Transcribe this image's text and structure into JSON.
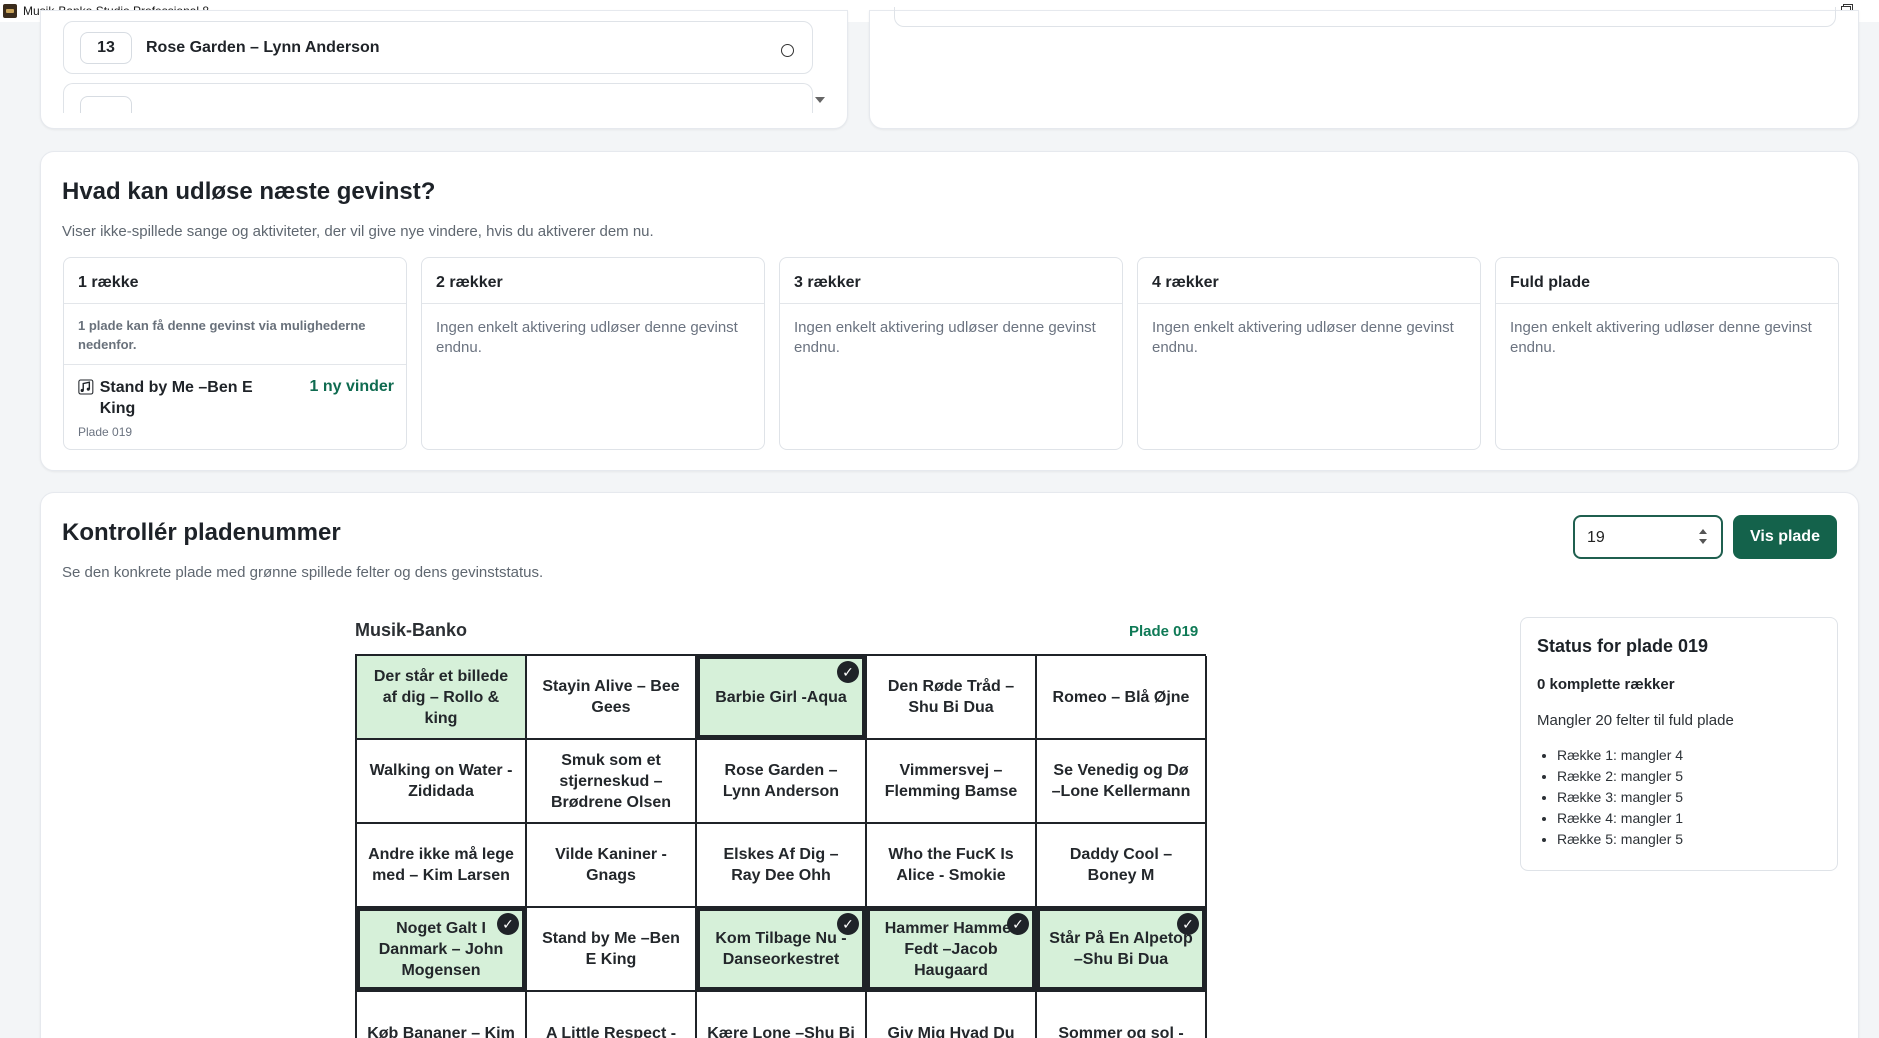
{
  "window": {
    "title": "Musik-Banko Studio Professional 8"
  },
  "song_list": {
    "visible_item": {
      "number": "13",
      "title": "Rose Garden – Lynn Anderson"
    }
  },
  "gains": {
    "title": "Hvad kan udløse næste gevinst?",
    "subtitle": "Viser ikke-spillede sange og aktiviteter, der vil give nye vindere, hvis du aktiverer dem nu.",
    "columns": [
      {
        "heading": "1 række",
        "info": "1 plade kan få denne gevinst via mulighederne nedenfor.",
        "item": {
          "song": "Stand by Me –Ben E King",
          "winners": "1 ny vinder",
          "plate": "Plade 019"
        }
      },
      {
        "heading": "2 rækker",
        "empty": "Ingen enkelt aktivering udløser denne gevinst endnu."
      },
      {
        "heading": "3 rækker",
        "empty": "Ingen enkelt aktivering udløser denne gevinst endnu."
      },
      {
        "heading": "4 rækker",
        "empty": "Ingen enkelt aktivering udløser denne gevinst endnu."
      },
      {
        "heading": "Fuld plade",
        "empty": "Ingen enkelt aktivering udløser denne gevinst endnu."
      }
    ]
  },
  "check": {
    "title": "Kontrollér pladenummer",
    "subtitle": "Se den konkrete plade med grønne spillede felter og dens gevinststatus.",
    "input_value": "19",
    "button_label": "Vis plade",
    "board_label": "Musik-Banko",
    "board_plate": "Plade 019",
    "cells": [
      {
        "text": "Der står et billede af dig – Rollo & king",
        "played": true,
        "bold": false,
        "check": false
      },
      {
        "text": "Stayin Alive – Bee Gees",
        "played": false,
        "bold": false,
        "check": false
      },
      {
        "text": "Barbie Girl -Aqua",
        "played": true,
        "bold": true,
        "check": true
      },
      {
        "text": "Den Røde Tråd – Shu Bi Dua",
        "played": false,
        "bold": false,
        "check": false
      },
      {
        "text": "Romeo – Blå Øjne",
        "played": false,
        "bold": false,
        "check": false
      },
      {
        "text": "Walking on Water -Zididada",
        "played": false,
        "bold": false,
        "check": false
      },
      {
        "text": "Smuk som et stjerneskud –Brødrene Olsen",
        "played": false,
        "bold": false,
        "check": false
      },
      {
        "text": "Rose Garden – Lynn Anderson",
        "played": false,
        "bold": false,
        "check": false
      },
      {
        "text": "Vimmersvej – Flemming Bamse",
        "played": false,
        "bold": false,
        "check": false
      },
      {
        "text": "Se Venedig og Dø –Lone Kellermann",
        "played": false,
        "bold": false,
        "check": false
      },
      {
        "text": "Andre ikke må lege med – Kim Larsen",
        "played": false,
        "bold": false,
        "check": false
      },
      {
        "text": "Vilde Kaniner - Gnags",
        "played": false,
        "bold": false,
        "check": false
      },
      {
        "text": "Elskes Af Dig – Ray Dee Ohh",
        "played": false,
        "bold": false,
        "check": false
      },
      {
        "text": "Who the FucK Is Alice - Smokie",
        "played": false,
        "bold": false,
        "check": false
      },
      {
        "text": "Daddy Cool – Boney M",
        "played": false,
        "bold": false,
        "check": false
      },
      {
        "text": "Noget Galt I Danmark – John Mogensen",
        "played": true,
        "bold": true,
        "check": true
      },
      {
        "text": "Stand by Me –Ben E King",
        "played": false,
        "bold": false,
        "check": false
      },
      {
        "text": "Kom Tilbage Nu -Danseorkestret",
        "played": true,
        "bold": true,
        "check": true
      },
      {
        "text": "Hammer Hammer Fedt –Jacob Haugaard",
        "played": true,
        "bold": true,
        "check": true
      },
      {
        "text": "Står På En Alpetop –Shu Bi Dua",
        "played": true,
        "bold": true,
        "check": true
      },
      {
        "text": "Køb Bananer – Kim",
        "played": false,
        "bold": false,
        "check": false
      },
      {
        "text": "A Little Respect -",
        "played": false,
        "bold": false,
        "check": false
      },
      {
        "text": "Kære Lone –Shu Bi",
        "played": false,
        "bold": false,
        "check": false
      },
      {
        "text": "Giv Mig Hvad Du",
        "played": false,
        "bold": false,
        "check": false
      },
      {
        "text": "Sommer og sol -",
        "played": false,
        "bold": false,
        "check": false
      }
    ],
    "status": {
      "title": "Status for plade 019",
      "complete": "0 komplette rækker",
      "missing": "Mangler 20 felter til fuld plade",
      "rows": [
        "Række 1: mangler 4",
        "Række 2: mangler 5",
        "Række 3: mangler 5",
        "Række 4: mangler 1",
        "Række 5: mangler 5"
      ]
    }
  },
  "colors": {
    "accent": "#14624b",
    "played": "#d6f0d9",
    "winner_text": "#0f6b50"
  }
}
